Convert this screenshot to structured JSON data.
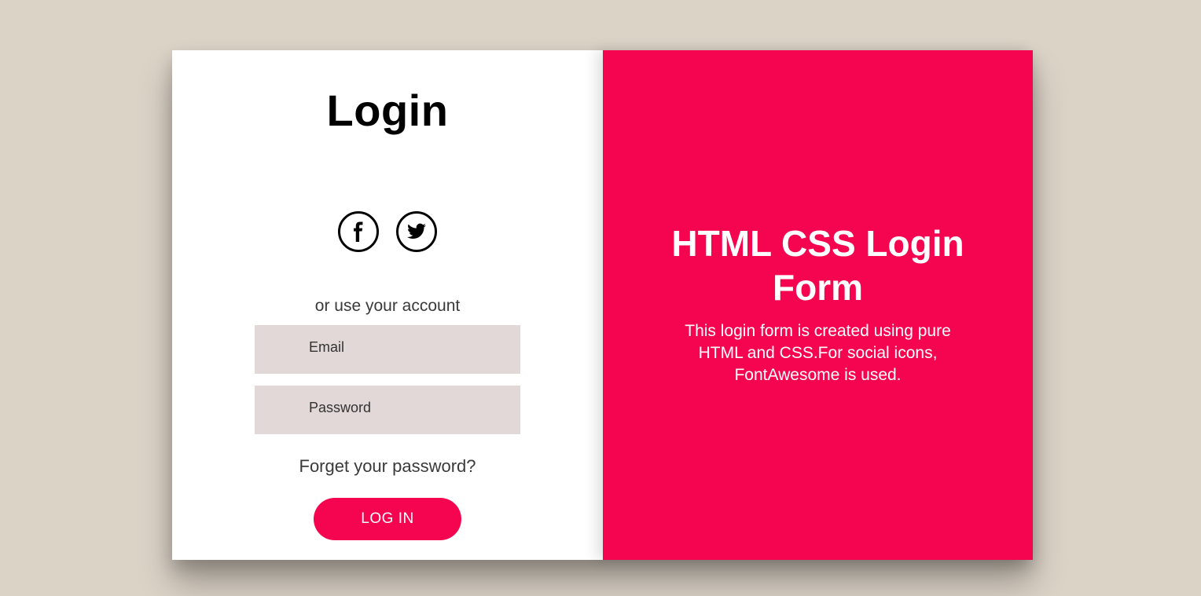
{
  "colors": {
    "background": "#dcd3c7",
    "accent": "#f5044f",
    "input_bg": "#e2d8d8"
  },
  "login": {
    "title": "Login",
    "social": [
      {
        "name": "facebook-icon"
      },
      {
        "name": "twitter-icon"
      }
    ],
    "or_text": "or use your account",
    "email_placeholder": "Email",
    "password_placeholder": "Password",
    "forget_text": "Forget your password?",
    "button_label": "LOG IN"
  },
  "hero": {
    "title": "HTML CSS Login Form",
    "description": "This login form is created using pure HTML and CSS.For social icons, FontAwesome is used."
  }
}
